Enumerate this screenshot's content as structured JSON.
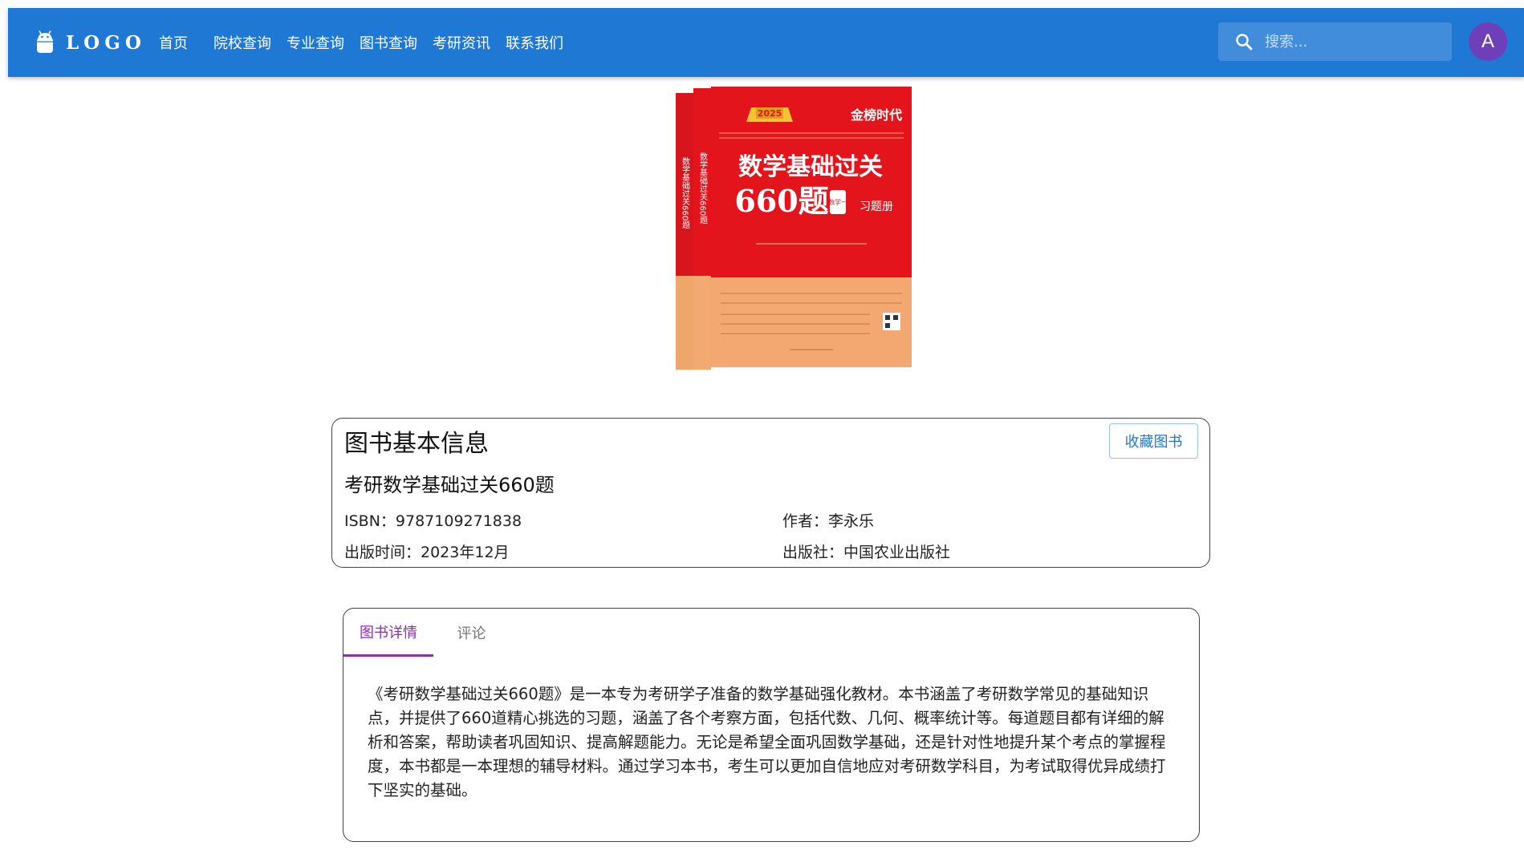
{
  "header": {
    "logo_text": "LOGO",
    "nav": [
      "首页",
      "院校查询",
      "专业查询",
      "图书查询",
      "考研资讯",
      "联系我们"
    ],
    "search_placeholder": "搜索...",
    "avatar_letter": "A"
  },
  "cover": {
    "brand": "金榜时代",
    "badge_year": "2025",
    "title_line1": "数学基础过关",
    "title_line2": "660题",
    "subject": "数学一",
    "volume": "习题册"
  },
  "book_info": {
    "section_title": "图书基本信息",
    "favorite_button": "收藏图书",
    "book_name": "考研数学基础过关660题",
    "isbn": "ISBN：9787109271838",
    "author": "作者：李永乐",
    "publish_date": "出版时间：2023年12月",
    "publisher": "出版社：中国农业出版社"
  },
  "detail": {
    "tabs": [
      "图书详情",
      "评论"
    ],
    "active_tab": "图书详情",
    "description": "《考研数学基础过关660题》是一本专为考研学子准备的数学基础强化教材。本书涵盖了考研数学常见的基础知识点，并提供了660道精心挑选的习题，涵盖了各个考察方面，包括代数、几何、概率统计等。每道题目都有详细的解析和答案，帮助读者巩固知识、提高解题能力。无论是希望全面巩固数学基础，还是针对性地提升某个考点的掌握程度，本书都是一本理想的辅导材料。通过学习本书，考生可以更加自信地应对考研数学科目，为考试取得优异成绩打下坚实的基础。"
  },
  "colors": {
    "appbar": "#1e78d4",
    "avatar": "#6d3fb8",
    "tab_active": "#8e2eb0",
    "cover_red": "#e3141c",
    "cover_peach": "#f2a870"
  }
}
